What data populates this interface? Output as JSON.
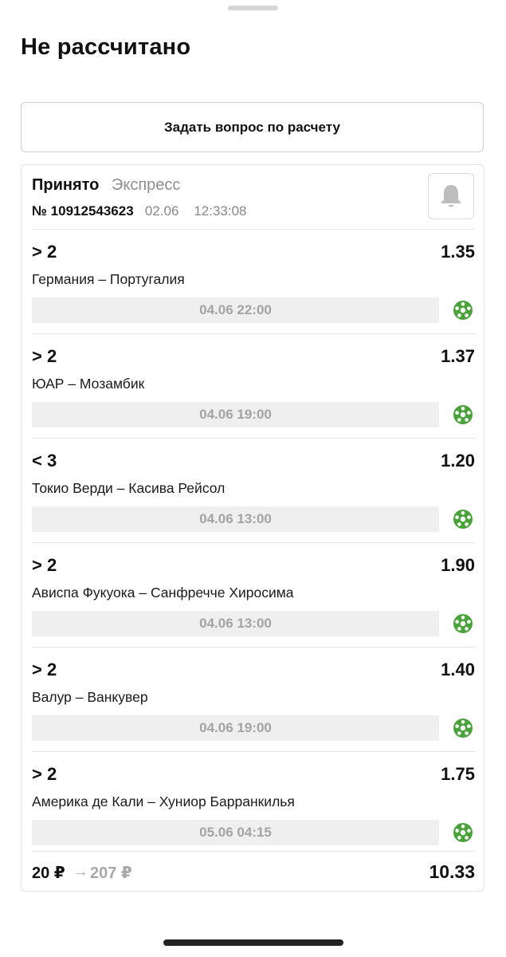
{
  "sheet": {
    "title": "Не рассчитано"
  },
  "ask_button": {
    "label": "Задать вопрос по расчету"
  },
  "bet": {
    "status": "Принято",
    "type": "Экспресс",
    "number": "№ 10912543623",
    "date": "02.06",
    "time": "12:33:08",
    "events": [
      {
        "selection": "> 2",
        "odds": "1.35",
        "teams": "Германия – Португалия",
        "datetime": "04.06 22:00",
        "sport_icon": "football-icon"
      },
      {
        "selection": "> 2",
        "odds": "1.37",
        "teams": "ЮАР – Мозамбик",
        "datetime": "04.06 19:00",
        "sport_icon": "football-icon"
      },
      {
        "selection": "< 3",
        "odds": "1.20",
        "teams": "Токио Верди – Касива Рейсол",
        "datetime": "04.06 13:00",
        "sport_icon": "football-icon"
      },
      {
        "selection": "> 2",
        "odds": "1.90",
        "teams": "Ависпа Фукуока – Санфречче Хиросима",
        "datetime": "04.06 13:00",
        "sport_icon": "football-icon"
      },
      {
        "selection": "> 2",
        "odds": "1.40",
        "teams": "Валур – Ванкувер",
        "datetime": "04.06 19:00",
        "sport_icon": "football-icon"
      },
      {
        "selection": "> 2",
        "odds": "1.75",
        "teams": "Америка де Кали – Хуниор Барранкилья",
        "datetime": "05.06 04:15",
        "sport_icon": "football-icon"
      }
    ],
    "stake": "20 ₽",
    "arrow": "→",
    "possible_win": "207 ₽",
    "total_odds": "10.33"
  },
  "colors": {
    "sport_icon_green": "#4aa23a",
    "date_bar_bg": "#efefef",
    "muted_text": "#8e8e8e"
  },
  "icons": {
    "bell": "bell-icon",
    "sport": "football-icon"
  }
}
